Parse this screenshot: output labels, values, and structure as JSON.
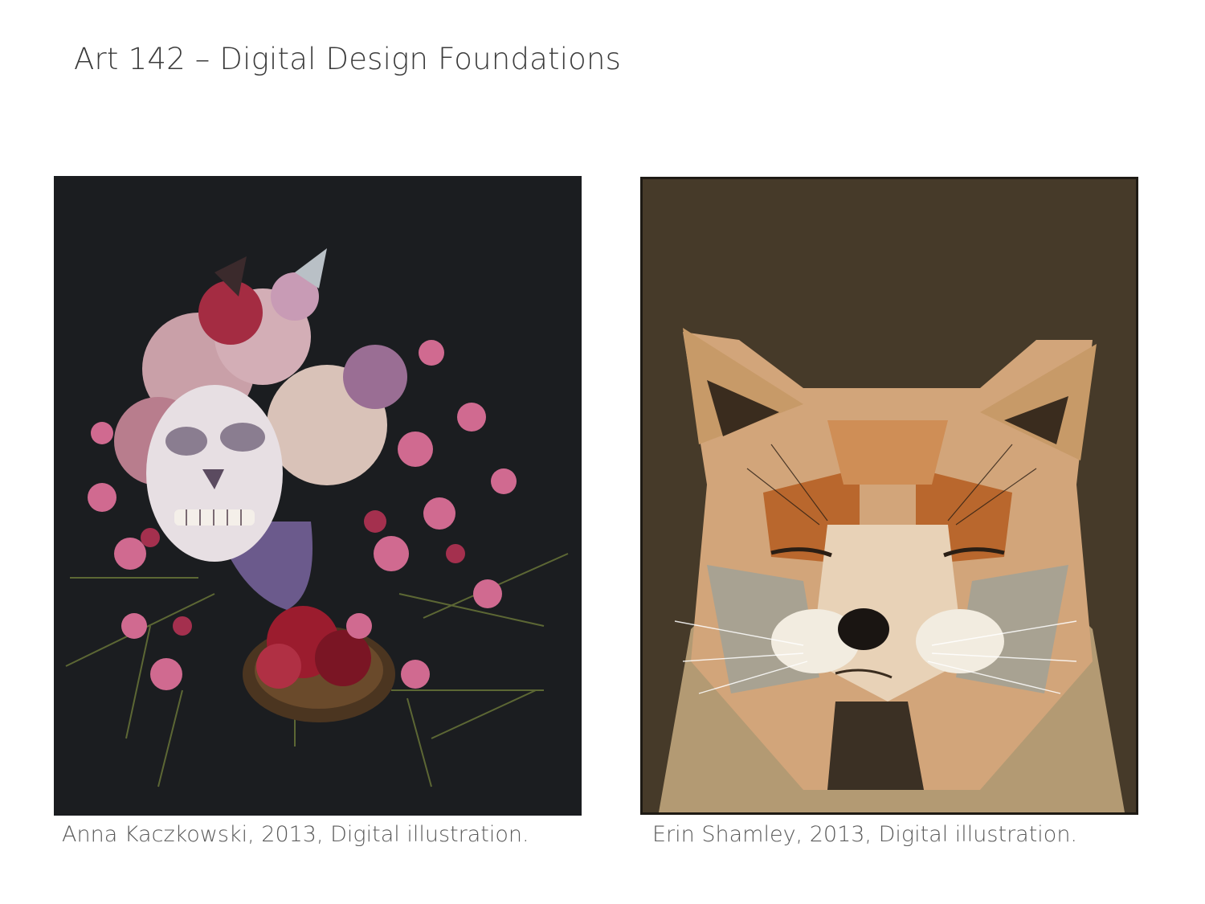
{
  "slide": {
    "title": "Art 142 – Digital Design Foundations"
  },
  "artworks": [
    {
      "caption": "Anna Kaczkowski, 2013, Digital illustration.",
      "background_color": "#1b1d20"
    },
    {
      "caption": "Erin Shamley, 2013, Digital illustration.",
      "background_color": "#463a29"
    }
  ]
}
